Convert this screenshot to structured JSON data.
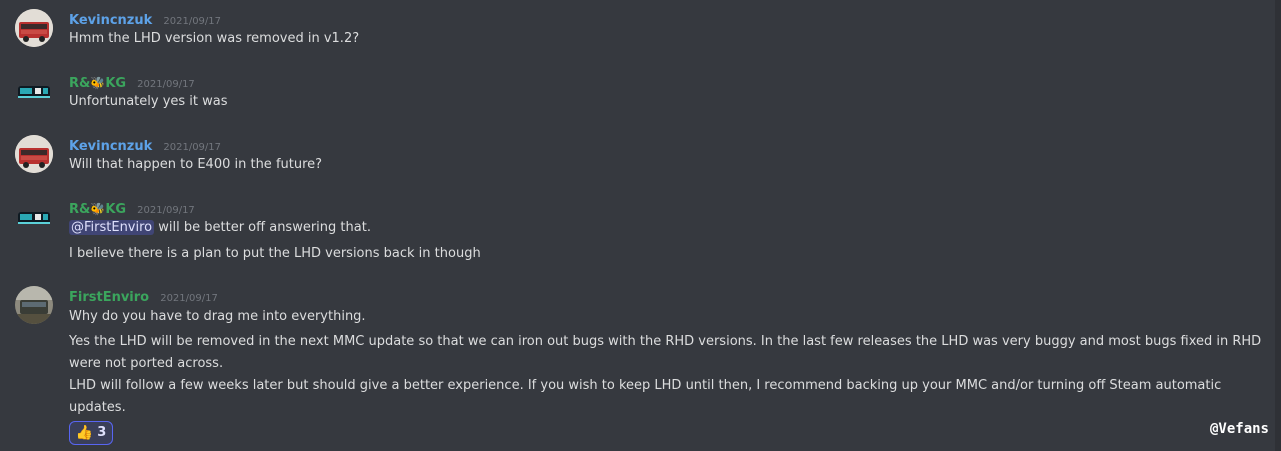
{
  "messages": [
    {
      "author": {
        "name": "Kevincnzuk",
        "name_color": "#5da2e8",
        "avatar": "bus-avatar"
      },
      "timestamp": "2021/09/17",
      "lines": [
        "Hmm the LHD version was removed in v1.2?"
      ]
    },
    {
      "author": {
        "name_prefix": "R&",
        "name_emoji": "🐝",
        "name_suffix": "KG",
        "name_color": "#3ba55d",
        "avatar": "bus-logo-avatar"
      },
      "timestamp": "2021/09/17",
      "lines": [
        "Unfortunately yes it was"
      ]
    },
    {
      "author": {
        "name": "Kevincnzuk",
        "name_color": "#5da2e8",
        "avatar": "bus-avatar"
      },
      "timestamp": "2021/09/17",
      "lines": [
        "Will that happen to E400 in the future?"
      ]
    },
    {
      "author": {
        "name_prefix": "R&",
        "name_emoji": "🐝",
        "name_suffix": "KG",
        "name_color": "#3ba55d",
        "avatar": "bus-logo-avatar"
      },
      "timestamp": "2021/09/17",
      "mention": "@FirstEnviro",
      "lines": [
        "will be better off answering that.",
        "I believe there is a plan to put the LHD versions back in though"
      ]
    },
    {
      "author": {
        "name": "FirstEnviro",
        "name_color": "#3ba55d",
        "avatar": "photo-avatar"
      },
      "timestamp": "2021/09/17",
      "lines": [
        "Why do you have to drag me into everything.",
        "Yes the LHD will be removed in the next MMC update so that we can iron out bugs with the RHD versions. In the last few releases the LHD was very buggy and most bugs fixed in RHD were not ported across.",
        "LHD will follow a few weeks later but should give a better experience. If you wish to keep LHD until then, I recommend backing up your MMC and/or turning off Steam automatic updates."
      ],
      "reaction": {
        "emoji": "👍",
        "emoji_name": "thumbs-up-icon",
        "count": "3"
      }
    }
  ],
  "watermark": "@Vefans",
  "colors": {
    "background": "#36393f",
    "text": "#dcddde",
    "timestamp": "#72767d",
    "mention_bg": "#414675",
    "reaction_border": "#5865f2"
  }
}
